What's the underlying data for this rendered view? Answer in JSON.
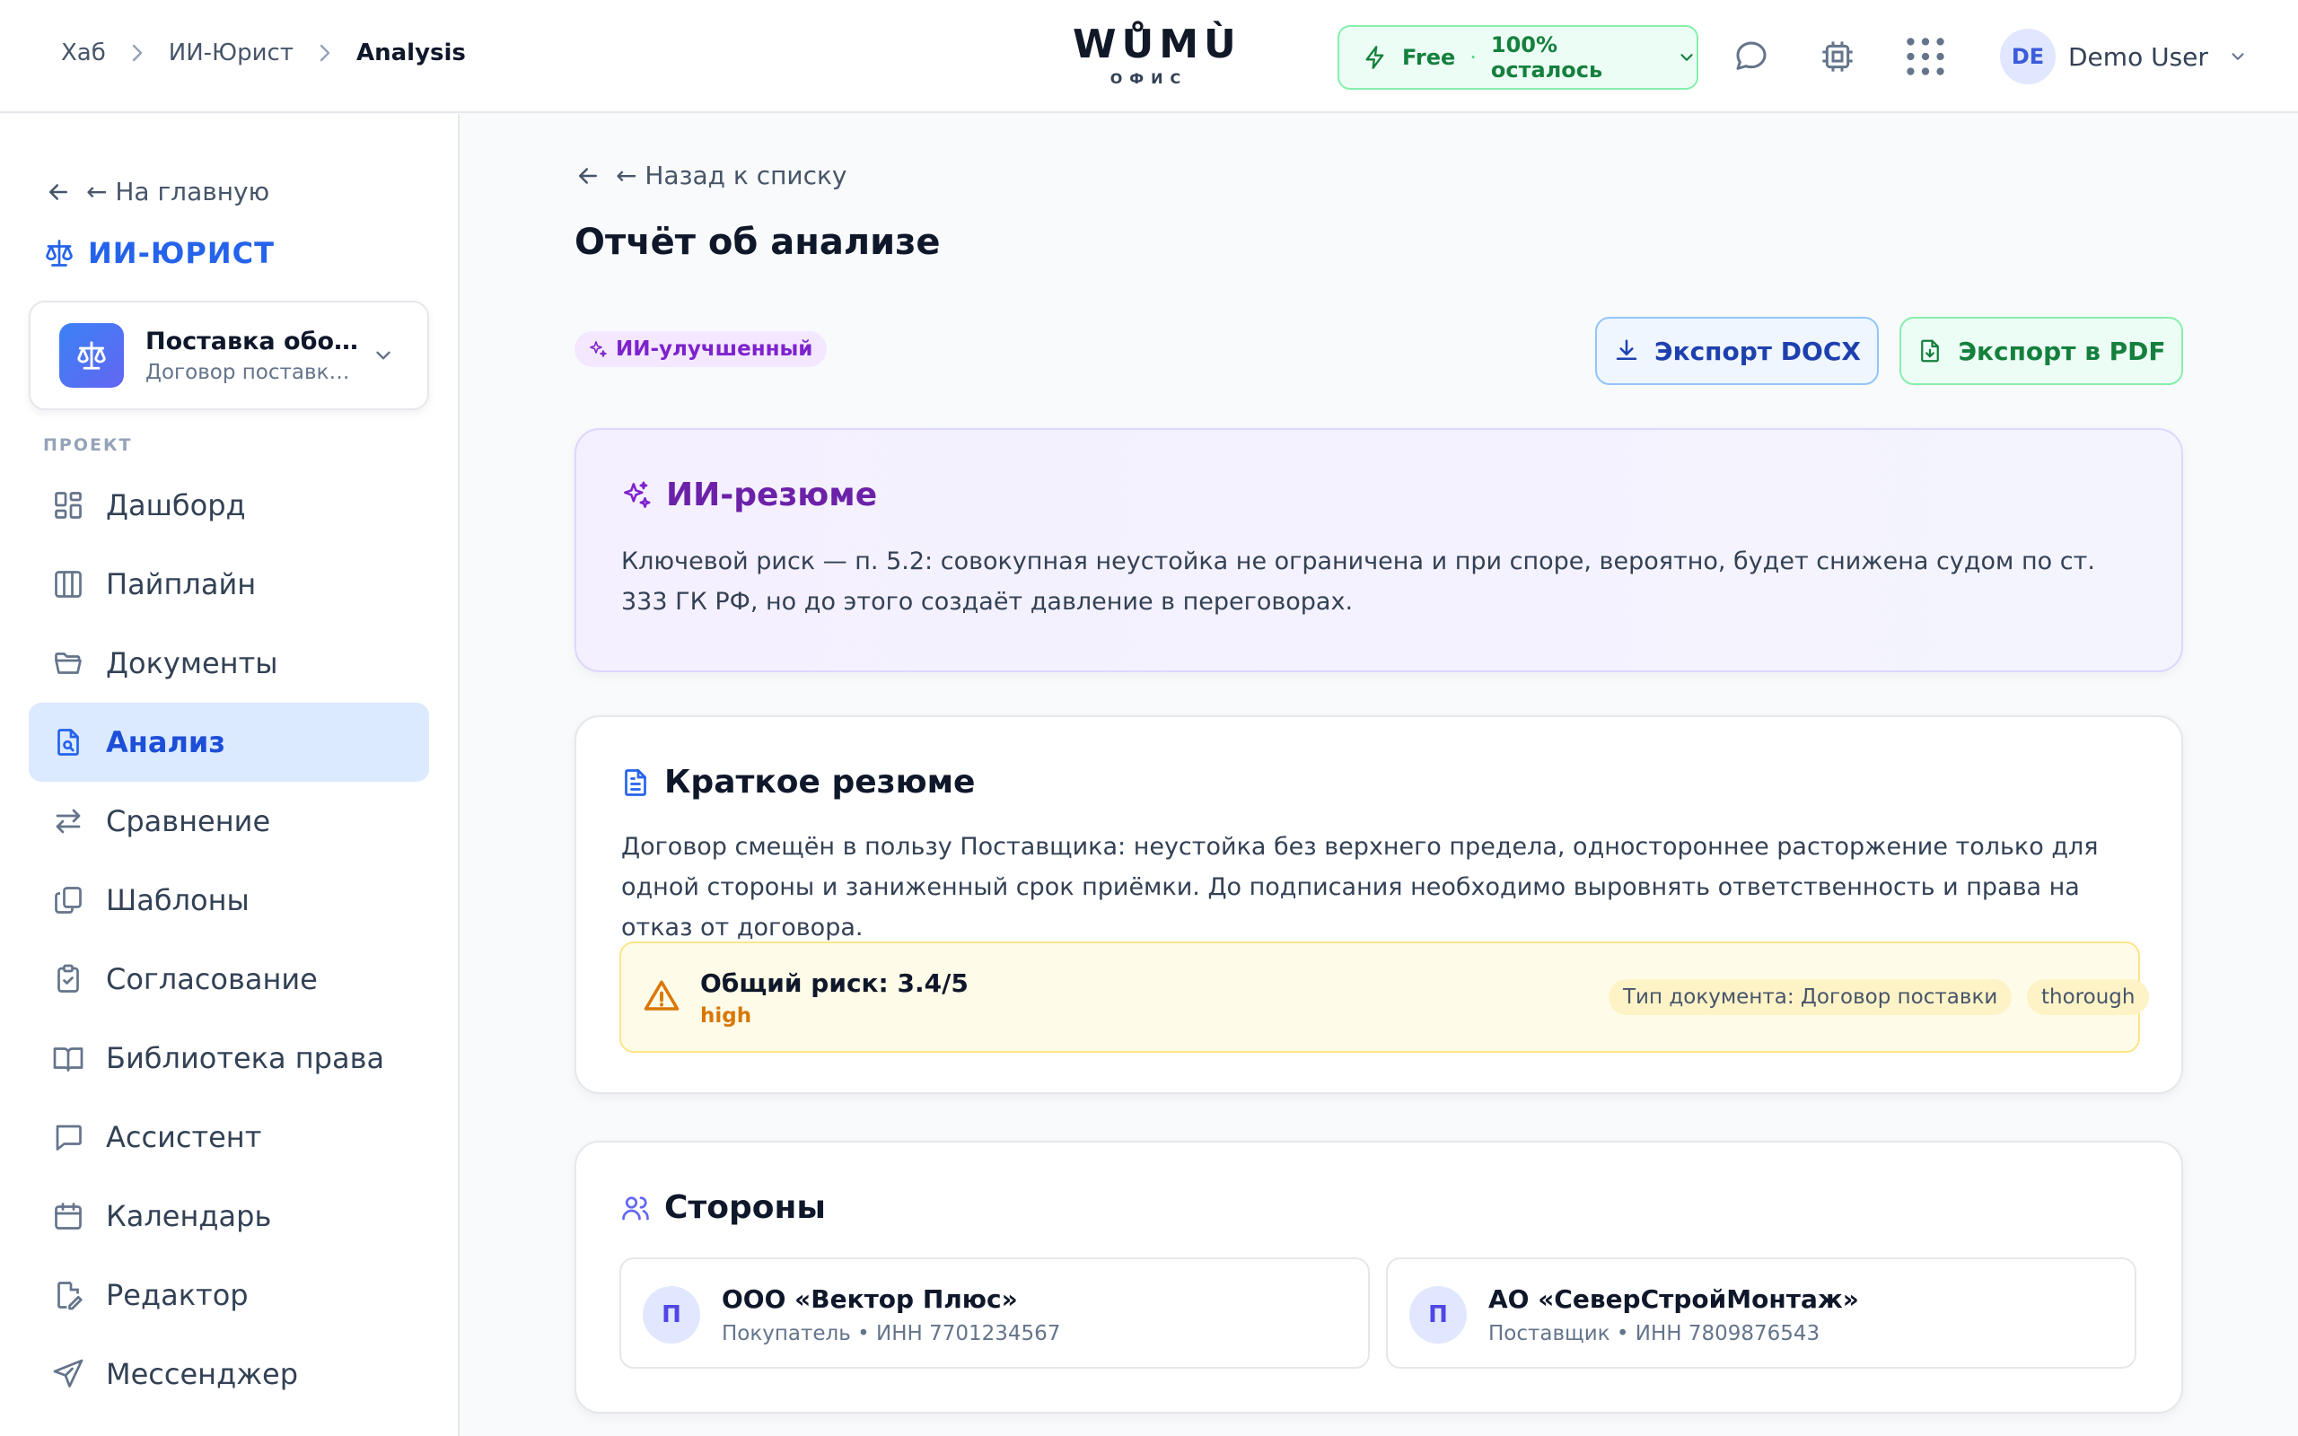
{
  "breadcrumb": {
    "items": [
      "Хаб",
      "ИИ-Юрист",
      "Analysis"
    ]
  },
  "logo": {
    "word": "WŮMÙ",
    "sub": "ОФИС"
  },
  "plan": {
    "name": "Free",
    "remaining": "100% осталось"
  },
  "user": {
    "initials": "DE",
    "name": "Demo User"
  },
  "sidebar": {
    "back_label": "← На главную",
    "brand": "ИИ-ЮРИСТ",
    "project": {
      "title": "Поставка обор...",
      "subtitle": "Договор поставки..."
    },
    "section_label": "ПРОЕКТ",
    "items": [
      {
        "label": "Дашборд",
        "icon": "grid-icon"
      },
      {
        "label": "Пайплайн",
        "icon": "columns-icon"
      },
      {
        "label": "Документы",
        "icon": "folder-icon"
      },
      {
        "label": "Анализ",
        "icon": "file-search-icon",
        "active": true
      },
      {
        "label": "Сравнение",
        "icon": "arrows-icon"
      },
      {
        "label": "Шаблоны",
        "icon": "copy-icon"
      },
      {
        "label": "Согласование",
        "icon": "clipboard-check-icon"
      },
      {
        "label": "Библиотека права",
        "icon": "book-icon"
      },
      {
        "label": "Ассистент",
        "icon": "chat-icon"
      },
      {
        "label": "Календарь",
        "icon": "calendar-icon"
      },
      {
        "label": "Редактор",
        "icon": "file-edit-icon"
      },
      {
        "label": "Мессенджер",
        "icon": "send-icon"
      }
    ]
  },
  "main": {
    "back_label": "← Назад к списку",
    "title": "Отчёт об анализе",
    "badge": "ИИ-улучшенный",
    "export_docx": "Экспорт DOCX",
    "export_pdf": "Экспорт в PDF",
    "ai_summary": {
      "title": "ИИ-резюме",
      "text": "Ключевой риск — п. 5.2: совокупная неустойка не ограничена и при споре, вероятно, будет снижена судом по ст. 333 ГК РФ, но до этого создаёт давление в переговорах."
    },
    "short_summary": {
      "title": "Краткое резюме",
      "text": "Договор смещён в пользу Поставщика: неустойка без верхнего предела, одностороннее расторжение только для одной стороны и заниженный срок приёмки. До подписания необходимо выровнять ответственность и права на отказ от договора.",
      "risk_title": "Общий риск: 3.4/5",
      "risk_level": "high",
      "doc_type": "Тип документа: Договор поставки",
      "mode": "thorough"
    },
    "parties": {
      "title": "Стороны",
      "items": [
        {
          "initial": "П",
          "name": "ООО «Вектор Плюс»",
          "role": "Покупатель • ИНН 7701234567"
        },
        {
          "initial": "П",
          "name": "АО «СеверСтройМонтаж»",
          "role": "Поставщик • ИНН 7809876543"
        }
      ]
    }
  },
  "colors": {
    "accent": "#2563eb",
    "ai": "#7e22ce",
    "warning": "#d97706",
    "success": "#15803d"
  }
}
